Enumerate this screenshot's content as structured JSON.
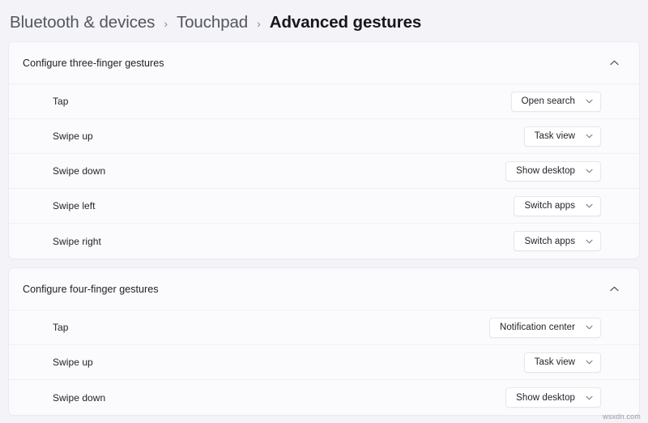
{
  "breadcrumb": {
    "items": [
      {
        "label": "Bluetooth & devices",
        "current": false
      },
      {
        "label": "Touchpad",
        "current": false
      },
      {
        "label": "Advanced gestures",
        "current": true
      }
    ],
    "separator": "›"
  },
  "sections": [
    {
      "title": "Configure three-finger gestures",
      "collapse_icon": "chevron-up-icon",
      "rows": [
        {
          "label": "Tap",
          "value": "Open search",
          "caret_icon": "chevron-down-icon"
        },
        {
          "label": "Swipe up",
          "value": "Task view",
          "caret_icon": "chevron-down-icon"
        },
        {
          "label": "Swipe down",
          "value": "Show desktop",
          "caret_icon": "chevron-down-icon"
        },
        {
          "label": "Swipe left",
          "value": "Switch apps",
          "caret_icon": "chevron-down-icon"
        },
        {
          "label": "Swipe right",
          "value": "Switch apps",
          "caret_icon": "chevron-down-icon"
        }
      ]
    },
    {
      "title": "Configure four-finger gestures",
      "collapse_icon": "chevron-up-icon",
      "rows": [
        {
          "label": "Tap",
          "value": "Notification center",
          "caret_icon": "chevron-down-icon"
        },
        {
          "label": "Swipe up",
          "value": "Task view",
          "caret_icon": "chevron-down-icon"
        },
        {
          "label": "Swipe down",
          "value": "Show desktop",
          "caret_icon": "chevron-down-icon"
        }
      ]
    }
  ],
  "watermark": "wsxdn.com",
  "colors": {
    "page_background": "#f3f3f8",
    "card_background": "#fbfbfd",
    "card_border": "#ebebf1",
    "text_primary": "#1d1e22",
    "text_secondary": "#53565e"
  }
}
